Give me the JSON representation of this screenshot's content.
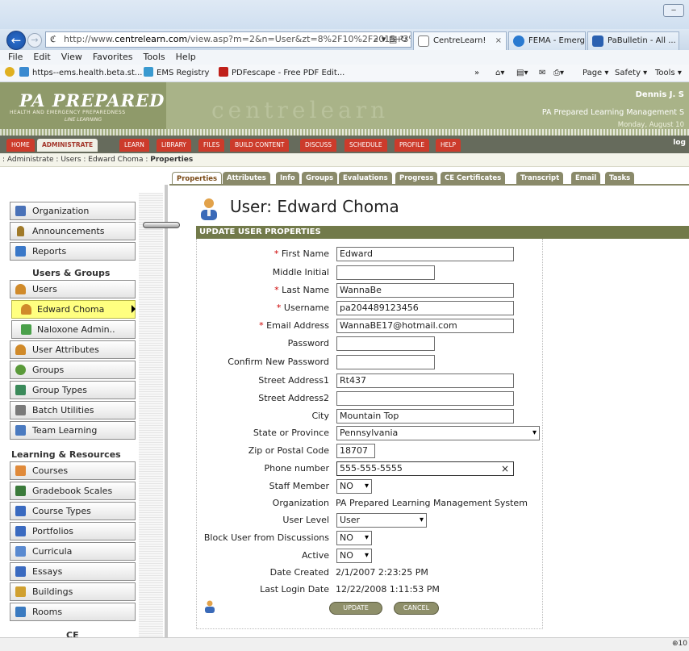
{
  "browser": {
    "url_prefix": "http://www.",
    "url_domain": "centrelearn.com",
    "url_rest": "/view.asp?m=2&n=User&zt=8%2F10%2F2015+3%3",
    "url_controls": "⌕ ▾ ▤ ↻",
    "tabs": [
      {
        "label": "CentreLearn!",
        "close": "×"
      },
      {
        "label": "FEMA - Emerg...",
        "close": ""
      },
      {
        "label": "PaBulletin - All ...",
        "close": ""
      }
    ],
    "menu": [
      "File",
      "Edit",
      "View",
      "Favorites",
      "Tools",
      "Help"
    ],
    "favorites": [
      "https--ems.health.beta.st...",
      "EMS Registry",
      "PDFescape - Free PDF Edit..."
    ],
    "fav_more": "»",
    "command_bar": [
      "Page ▾",
      "Safety ▾",
      "Tools ▾"
    ],
    "zoom": "⊕10"
  },
  "banner": {
    "logo_main": "PA PREPARED",
    "logo_sub": "HEALTH AND EMERGENCY PREPAREDNESS",
    "logo_sub2": "LINE LEARNING",
    "brand": "centrelearn",
    "user_name": "Dennis J. S",
    "system_name": "PA Prepared Learning Management S",
    "date": "Monday, August 10"
  },
  "main_nav": {
    "items": [
      "HOME",
      "ADMINISTRATE",
      "LEARN",
      "LIBRARY",
      "FILES",
      "BUILD CONTENT",
      "DISCUSS",
      "SCHEDULE",
      "PROFILE",
      "HELP"
    ],
    "active": "ADMINISTRATE",
    "logout": "log"
  },
  "breadcrumb": {
    "path": ": Administrate : Users : Edward Choma : ",
    "current": "Properties"
  },
  "sub_tabs": [
    "Properties",
    "Attributes",
    "Info",
    "Groups",
    "Evaluations",
    "Progress",
    "CE Certificates",
    "Transcript",
    "Email",
    "Tasks"
  ],
  "sidebar": {
    "items": [
      {
        "label": "Organization",
        "icon": "org-chart-icon",
        "color": "#4a72b8"
      },
      {
        "label": "Announcements",
        "icon": "microphone-icon",
        "color": "#a07a2a"
      },
      {
        "label": "Reports",
        "icon": "report-icon",
        "color": "#3a78c8"
      }
    ],
    "section_users": "Users & Groups",
    "users_items": [
      {
        "label": "Users",
        "icon": "user-icon",
        "color": "#d08a2a"
      },
      {
        "label": "Edward Choma",
        "icon": "user-icon",
        "color": "#d08a2a"
      },
      {
        "label": "Naloxone Admin..",
        "icon": "certificate-icon",
        "color": "#4aa04a"
      },
      {
        "label": "User Attributes",
        "icon": "user-icon",
        "color": "#d08a2a"
      },
      {
        "label": "Groups",
        "icon": "group-icon",
        "color": "#5a9a3a"
      },
      {
        "label": "Group Types",
        "icon": "group-types-icon",
        "color": "#3a8a5a"
      },
      {
        "label": "Batch Utilities",
        "icon": "wrench-icon",
        "color": "#7a7a7a"
      },
      {
        "label": "Team Learning",
        "icon": "team-icon",
        "color": "#4a7ac0"
      }
    ],
    "section_learning": "Learning & Resources",
    "learning_items": [
      {
        "label": "Courses",
        "icon": "document-icon",
        "color": "#e08a3a"
      },
      {
        "label": "Gradebook Scales",
        "icon": "grid-icon",
        "color": "#3a7a3a"
      },
      {
        "label": "Course Types",
        "icon": "books-icon",
        "color": "#3a6ac0"
      },
      {
        "label": "Portfolios",
        "icon": "portfolio-icon",
        "color": "#3a6ac0"
      },
      {
        "label": "Curricula",
        "icon": "curricula-icon",
        "color": "#5a8ad0"
      },
      {
        "label": "Essays",
        "icon": "essay-icon",
        "color": "#3a6ac0"
      },
      {
        "label": "Buildings",
        "icon": "building-icon",
        "color": "#d0a030"
      },
      {
        "label": "Rooms",
        "icon": "room-icon",
        "color": "#3a7ac0"
      }
    ],
    "section_ce": "CE"
  },
  "page": {
    "title": "User: Edward Choma",
    "section_bar": "UPDATE USER PROPERTIES",
    "required_mark": "*",
    "fields": [
      {
        "label": "First Name",
        "required": true,
        "value": "Edward",
        "type": "text",
        "width": 220
      },
      {
        "label": "Middle Initial",
        "required": false,
        "value": "",
        "type": "text",
        "width": 122
      },
      {
        "label": "Last Name",
        "required": true,
        "value": "WannaBe",
        "type": "text",
        "width": 220
      },
      {
        "label": "Username",
        "required": true,
        "value": "pa204489123456",
        "type": "text",
        "width": 220
      },
      {
        "label": "Email Address",
        "required": true,
        "value": "WannaBE17@hotmail.com",
        "type": "text",
        "width": 220
      },
      {
        "label": "Password",
        "required": false,
        "value": "",
        "type": "text",
        "width": 122
      },
      {
        "label": "Confirm New Password",
        "required": false,
        "value": "",
        "type": "text",
        "width": 122
      },
      {
        "label": "Street Address1",
        "required": false,
        "value": "Rt437",
        "type": "text",
        "width": 220
      },
      {
        "label": "Street Address2",
        "required": false,
        "value": "",
        "type": "text",
        "width": 220
      },
      {
        "label": "City",
        "required": false,
        "value": "Mountain Top",
        "type": "text",
        "width": 220
      },
      {
        "label": "State or Province",
        "required": false,
        "value": "Pennsylvania",
        "type": "select",
        "width": 252
      },
      {
        "label": "Zip or Postal Code",
        "required": false,
        "value": "18707",
        "type": "text",
        "width": 48
      },
      {
        "label": "Phone number",
        "required": false,
        "value": "555-555-5555",
        "type": "text-clear",
        "width": 220
      },
      {
        "label": "Staff Member",
        "required": false,
        "value": "NO",
        "type": "select",
        "width": 44
      },
      {
        "label": "Organization",
        "required": false,
        "value": "PA Prepared Learning Management System",
        "type": "static",
        "width": 0
      },
      {
        "label": "User Level",
        "required": false,
        "value": "User",
        "type": "select",
        "width": 112
      },
      {
        "label": "Block User from Discussions",
        "required": false,
        "value": "NO",
        "type": "select",
        "width": 44
      },
      {
        "label": "Active",
        "required": false,
        "value": "NO",
        "type": "select",
        "width": 44
      },
      {
        "label": "Date Created",
        "required": false,
        "value": "2/1/2007 2:23:25 PM",
        "type": "static",
        "width": 0
      },
      {
        "label": "Last Login Date",
        "required": false,
        "value": "12/22/2008 1:11:53 PM",
        "type": "static",
        "width": 0
      }
    ],
    "dropdown_arrow": "▾",
    "clear_mark": "×",
    "update_button": "UPDATE",
    "cancel_button": "CANCEL"
  },
  "colors": {
    "accent_red": "#cc3b2b",
    "olive": "#727a4a",
    "selected_yellow": "#ffff80"
  }
}
